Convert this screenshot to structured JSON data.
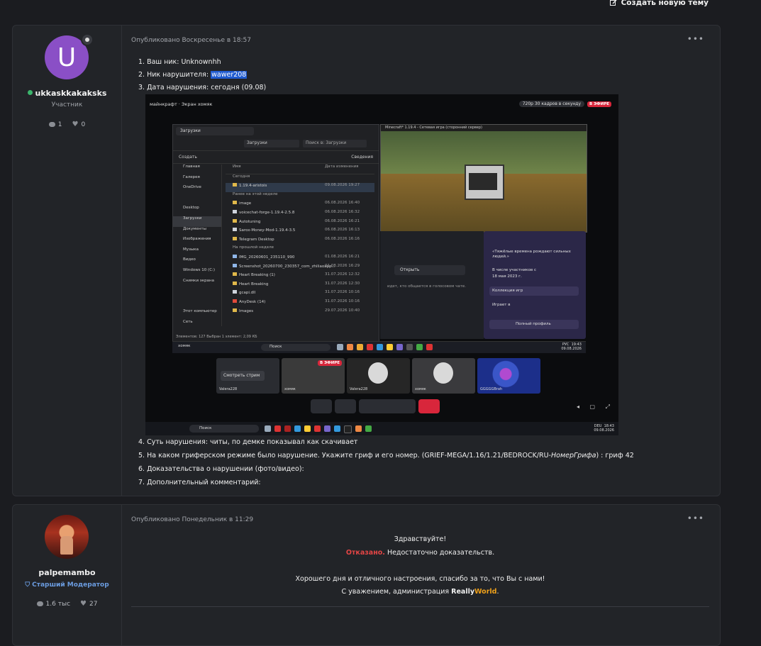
{
  "header": {
    "new_topic_label": "Создать новую тему"
  },
  "post1": {
    "author": {
      "avatar_letter": "U",
      "username": "ukkaskkakaksks",
      "role": "Участник",
      "stats": {
        "posts": "1",
        "reactions": "0"
      }
    },
    "meta": "Опубликовано Воскресенье в 18:57",
    "menu": "•••",
    "lines_top": [
      "1. Ваш ник: Unknownhh",
      "2. Ник нарушителя: ",
      "3. Дата нарушения: сегодня (09.08)"
    ],
    "violator_nick": "wawer208",
    "lines_bottom": [
      "4. Суть нарушения: читы, по демке показывал как скачивает",
      "5. На каком гриферском режиме было нарушение. Укажите гриф и его номер. (GRIEF-MEGA/1.16/1.21/BEDROCK/RU-",
      "НомерГрифа",
      ") : гриф 42",
      "6. Доказательства о нарушении (фото/видео):",
      "7. Дополнительный комментарий:"
    ],
    "screenshot": {
      "top_left": "майнкрафт  ·  Экран хомяк",
      "quality": "720p 30 кадров в секунду",
      "live": "В ЭФИРЕ",
      "explorer": {
        "tab": "Загрузки",
        "path": "Загрузки",
        "search": "Поиск в: Загрузки",
        "create": "Создать",
        "details": "Сведения",
        "sidebar": [
          "Главная",
          "Галерея",
          "OneDrive",
          "",
          "Desktop",
          "Загрузки",
          "Документы",
          "Изображения",
          "Музыка",
          "Видео",
          "Windows 10 (C:)",
          "Снимки экрана",
          "",
          "",
          "Этот компьютер",
          "Сеть"
        ],
        "col_name": "Имя",
        "col_date": "Дата изменения",
        "groups": [
          "Сегодня",
          "Ранее на этой неделе",
          "На прошлой неделе"
        ],
        "rows_today": [
          {
            "n": "1.19.4-aristois",
            "d": "09.08.2026 19:27"
          }
        ],
        "rows_week": [
          {
            "n": "image",
            "d": "06.08.2026 16:40"
          },
          {
            "n": "voicechat-forge-1.19.4-2.5.8",
            "d": "06.08.2026 16:32"
          },
          {
            "n": "Autotuning",
            "d": "06.08.2026 16:21"
          },
          {
            "n": "Sarox-Money-Mod-1.19.4-3.5",
            "d": "06.08.2026 16:13"
          },
          {
            "n": "Telegram Desktop",
            "d": "06.08.2026 16:16"
          }
        ],
        "rows_last": [
          {
            "n": "IMG_20260601_235110_990",
            "d": "01.08.2026 16:21"
          },
          {
            "n": "Screenshot_20260700_230357_com_zhiliaoapp...",
            "d": "01.08.2026 16:29"
          },
          {
            "n": "Heart Breaking (1)",
            "d": "31.07.2026 12:32"
          },
          {
            "n": "Heart Breaking",
            "d": "31.07.2026 12:30"
          },
          {
            "n": "gcapi.dll",
            "d": "31.07.2026 10:16"
          },
          {
            "n": "AnyDesk (14)",
            "d": "31.07.2026 10:16"
          },
          {
            "n": "Images",
            "d": "29.07.2026 10:40"
          }
        ],
        "status": "Элементов: 127   Выбран 1 элемент: 2,09 КБ"
      },
      "minecraft_title": "Minecraft* 1.19.4 - Сетевая игра (сторонний сервер)",
      "discord_open": "Открыть",
      "discord_voice_hint": "идет, кто общается в голосовом чате.",
      "discord_profile": {
        "quote": "«Тяжёлые времена рождают сильных людей.»",
        "member_since_label": "В числе участников с",
        "member_since": "18 мая 2023 г.",
        "games": "Коллекция игр",
        "playing": "Играет в",
        "full_profile": "Полный профиль"
      },
      "taskbar1": {
        "user": "хомяк",
        "search": "Поиск",
        "lang": "РУС",
        "time": "19:43",
        "date": "09.08.2026"
      },
      "tiles": [
        {
          "label": "Valera228",
          "button": "Смотреть стрим"
        },
        {
          "label": "хомяк",
          "live": "В ЭФИРЕ"
        },
        {
          "label": "Valera228"
        },
        {
          "label": "хомяк"
        },
        {
          "label": "GGGGGBrah"
        }
      ],
      "taskbar2": {
        "search": "Поиск",
        "lang": "DEU",
        "time": "18:43",
        "date": "09.08.2026"
      }
    }
  },
  "post2": {
    "author": {
      "username": "palpemambo",
      "role": "Старший Модератор",
      "stats": {
        "posts": "1.6 тыс",
        "reactions": "27"
      }
    },
    "meta": "Опубликовано Понедельник в 11:29",
    "menu": "•••",
    "greeting": "Здравствуйте!",
    "verdict": "Отказано.",
    "reason": " Недостаточно доказательств.",
    "wish": "Хорошего дня и отличного настроения, спасибо за то, что Вы с нами!",
    "sign_prefix": "С уважением, администрация ",
    "brand_a": "Really",
    "brand_b": "World",
    "brand_dot": "."
  }
}
